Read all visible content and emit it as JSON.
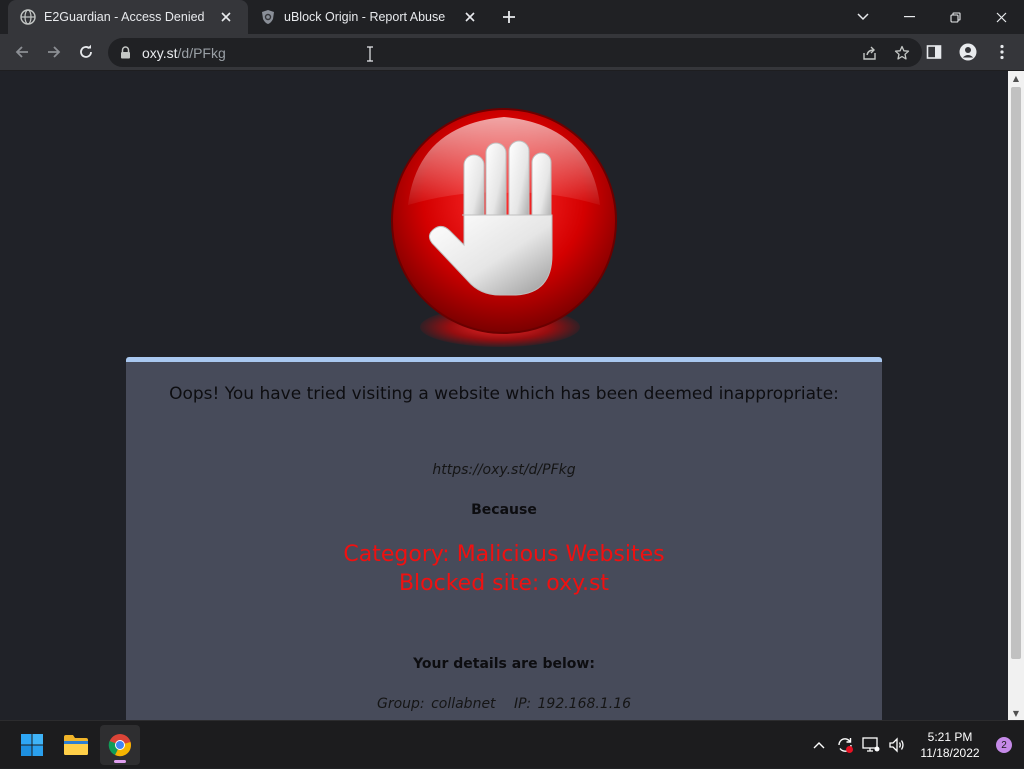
{
  "browser": {
    "tabs": [
      {
        "title": "E2Guardian - Access Denied",
        "active": true,
        "favicon": "globe-icon"
      },
      {
        "title": "uBlock Origin - Report Abuse",
        "active": false,
        "favicon": "ublock-icon"
      }
    ],
    "address": {
      "host": "oxy.st",
      "path": "/d/PFkg"
    }
  },
  "page": {
    "headline": "Oops! You have tried visiting a website which has been deemed inappropriate:",
    "blocked_url": "https://oxy.st/d/PFkg",
    "because_label": "Because",
    "reason_category": "Category: Malicious Websites",
    "reason_site": "Blocked site: oxy.st",
    "details_heading": "Your details are below:",
    "group": "Group: collabnet",
    "ip": "IP: 192.168.1.16",
    "accent_color": "#f01010",
    "card_bg": "#474b5a"
  },
  "taskbar": {
    "apps": [
      "start-icon",
      "file-explorer-icon",
      "chrome-icon"
    ],
    "time": "5:21 PM",
    "date": "11/18/2022",
    "notifications": "2"
  }
}
